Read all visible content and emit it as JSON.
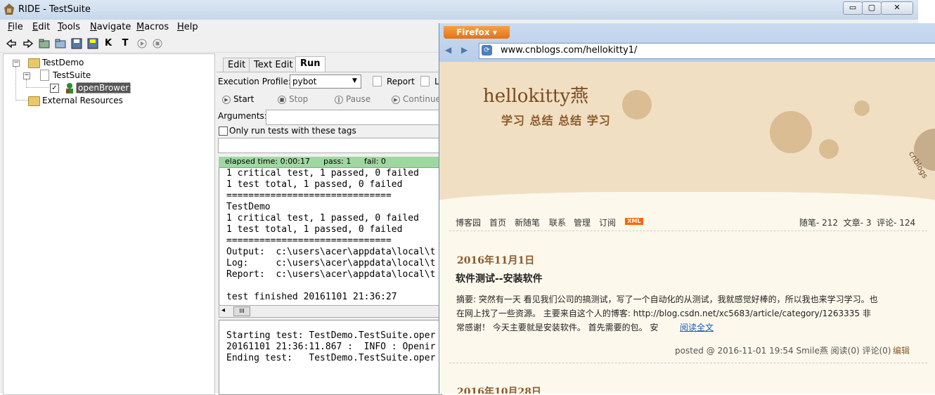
{
  "ride": {
    "title": "RIDE - TestSuite",
    "window_buttons": {
      "min": "▭",
      "max": "▢",
      "close": "✕"
    },
    "menu": [
      "File",
      "Edit",
      "Tools",
      "Navigate",
      "Macros",
      "Help"
    ],
    "toolbar_icons": [
      "back-icon",
      "forward-icon",
      "open-folder-icon",
      "open-directory-icon",
      "save-icon",
      "save-all-icon",
      "keyword-search-icon",
      "test-search-icon",
      "run-icon",
      "stop-icon"
    ],
    "toolbar_glyphs": {
      "k": "K",
      "t": "T"
    },
    "tree": {
      "root": "TestDemo",
      "suite": "TestSuite",
      "test": "openBrower",
      "external": "External Resources",
      "expander_glyph": "−",
      "check_glyph": "✓"
    },
    "tabs": [
      "Edit",
      "Text Edit",
      "Run"
    ],
    "active_tab": "Run",
    "execution_profile_label": "Execution Profile:",
    "execution_profile_value": "pybot",
    "report_label": "Report",
    "log_label_partial": "L",
    "controls": {
      "start": "Start",
      "stop": "Stop",
      "pause": "Pause",
      "continue": "Continue"
    },
    "control_glyphs": {
      "start": "▶",
      "stop": "■",
      "pause": "‖",
      "continue": "▶"
    },
    "arguments_label": "Arguments:",
    "only_run_tags": "Only run tests with these tags",
    "status": {
      "elapsed": "elapsed time: 0:00:17",
      "pass": "pass: 1",
      "fail": "fail: 0"
    },
    "output_lines": [
      "1 critical test, 1 passed, 0 failed",
      "1 test total, 1 passed, 0 failed",
      "==============================",
      "TestDemo",
      "1 critical test, 1 passed, 0 failed",
      "1 test total, 1 passed, 0 failed",
      "==============================",
      "Output:  c:\\users\\acer\\appdata\\local\\t",
      "Log:     c:\\users\\acer\\appdata\\local\\t",
      "Report:  c:\\users\\acer\\appdata\\local\\t",
      "",
      "test finished 20161101 21:36:27"
    ],
    "log_lines": [
      "Starting test: TestDemo.TestSuite.oper",
      "20161101 21:36:11.867 :  INFO : Openir",
      "Ending test:   TestDemo.TestSuite.oper"
    ],
    "scroll_glyphs": {
      "left": "◂",
      "thumb": "III"
    }
  },
  "firefox": {
    "button_label": "Firefox",
    "dropdown_glyph": "▾",
    "nav_glyphs": {
      "back": "◀",
      "forward": "▶",
      "site": "⟳"
    },
    "url": "www.cnblogs.com/hellokitty1/",
    "blog_title": "hellokitty燕",
    "blog_subtitle": "学习 总结 总结 学习",
    "watermark": "cnblogs",
    "nav": [
      "博客园",
      "首页",
      "新随笔",
      "联系",
      "管理",
      "订阅"
    ],
    "xml_badge": "XML",
    "stats": "随笔- 212  文章- 3  评论- 124",
    "post_date": "2016年11月1日",
    "post_title": "软件测试--安装软件",
    "summary_line1": "摘要: 突然有一天 看见我们公司的搞测试，写了一个自动化的从测试，我就感觉好棒的，所以我也来学习学习。也",
    "summary_line2": "在网上找了一些资源。 主要来自这个人的博客: http://blog.csdn.net/xc5683/article/category/1263335 非",
    "summary_line3": "常感谢！ 今天主要就是安装软件。 首先需要的包。 安",
    "read_more": "阅读全文",
    "posted": "posted @ 2016-11-01 19:54 Smile燕 阅读(0) 评论(0)",
    "edit_link": "编辑",
    "next_date_partial": "2016年10月28日"
  },
  "colors": {
    "banner": "#f0dfc2",
    "title_brown": "#7a4a1e",
    "date_brown": "#8a5a2a",
    "firefox_orange": "#e1731b",
    "pass_green": "#9fd89f"
  }
}
